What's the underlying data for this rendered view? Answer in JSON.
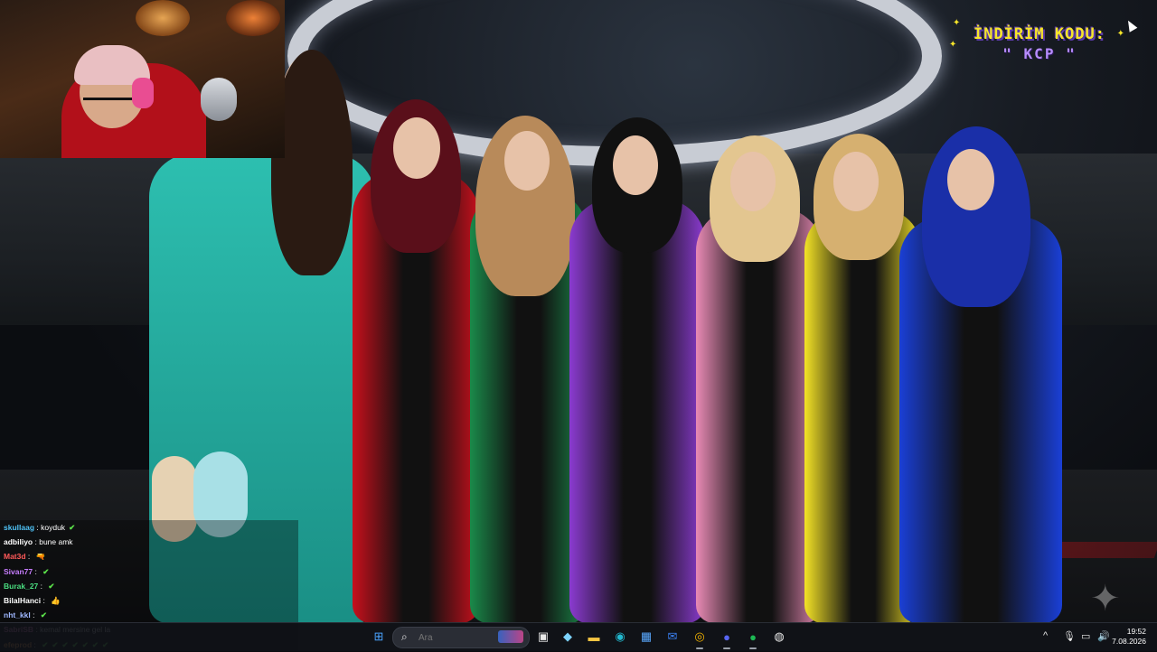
{
  "promo": {
    "line1": "İNDİRİM KODU:",
    "line2": "\" KCP \""
  },
  "chat": {
    "messages": [
      {
        "user": "skullaag",
        "sep": " : ",
        "text": "koyduk",
        "emotes": [
          "✔"
        ],
        "color": "#4fc3f7"
      },
      {
        "user": "adbiliyo",
        "sep": " : ",
        "text": "bune amk",
        "emotes": [],
        "color": "#ffffff"
      },
      {
        "user": "Mat3d",
        "sep": " : ",
        "text": "",
        "emotes": [
          "🔫"
        ],
        "color": "#ff5a5a"
      },
      {
        "user": "Sivan77",
        "sep": " : ",
        "text": "",
        "emotes": [
          "✔"
        ],
        "color": "#c77dff"
      },
      {
        "user": "Burak_27",
        "sep": " : ",
        "text": "",
        "emotes": [
          "✔"
        ],
        "color": "#4ade80"
      },
      {
        "user": "BilalHanci",
        "sep": " : ",
        "text": "",
        "emotes": [
          "👍"
        ],
        "color": "#ffffff"
      },
      {
        "user": "nht_kkl",
        "sep": " : ",
        "text": "",
        "emotes": [
          "✔"
        ],
        "color": "#9fb7ff"
      },
      {
        "user": "SabriSB",
        "sep": " : ",
        "text": "kemal mersine gel la",
        "emotes": [],
        "color": "#ff8ad8"
      },
      {
        "user": "efeprod",
        "sep": " : ",
        "text": "",
        "emotes": [
          "✔",
          "✔",
          "✔",
          "✔",
          "✔",
          "✔",
          "✔"
        ],
        "color": "#ffa94d"
      }
    ]
  },
  "taskbar": {
    "search_placeholder": "Ara",
    "apps": [
      {
        "name": "windows-start-icon",
        "glyph": "⊞",
        "color": "#4aa3ff"
      },
      {
        "name": "task-view-icon",
        "glyph": "▣",
        "color": "#e8e8e8"
      },
      {
        "name": "copilot-icon",
        "glyph": "◆",
        "color": "#7dd3fc"
      },
      {
        "name": "file-explorer-icon",
        "glyph": "▬",
        "color": "#f5c542"
      },
      {
        "name": "edge-icon",
        "glyph": "◉",
        "color": "#22b8cf"
      },
      {
        "name": "store-icon",
        "glyph": "▦",
        "color": "#5aa9ff"
      },
      {
        "name": "mail-icon",
        "glyph": "✉",
        "color": "#3b82f6"
      },
      {
        "name": "chrome-icon",
        "glyph": "◎",
        "color": "#f4b400"
      },
      {
        "name": "discord-icon",
        "glyph": "●",
        "color": "#5865f2"
      },
      {
        "name": "spotify-icon",
        "glyph": "●",
        "color": "#1db954"
      },
      {
        "name": "steam-icon",
        "glyph": "◍",
        "color": "#e8e8e8"
      }
    ],
    "tray": {
      "chevron": "^",
      "time": "19:52",
      "date": "7.08.2026"
    }
  }
}
